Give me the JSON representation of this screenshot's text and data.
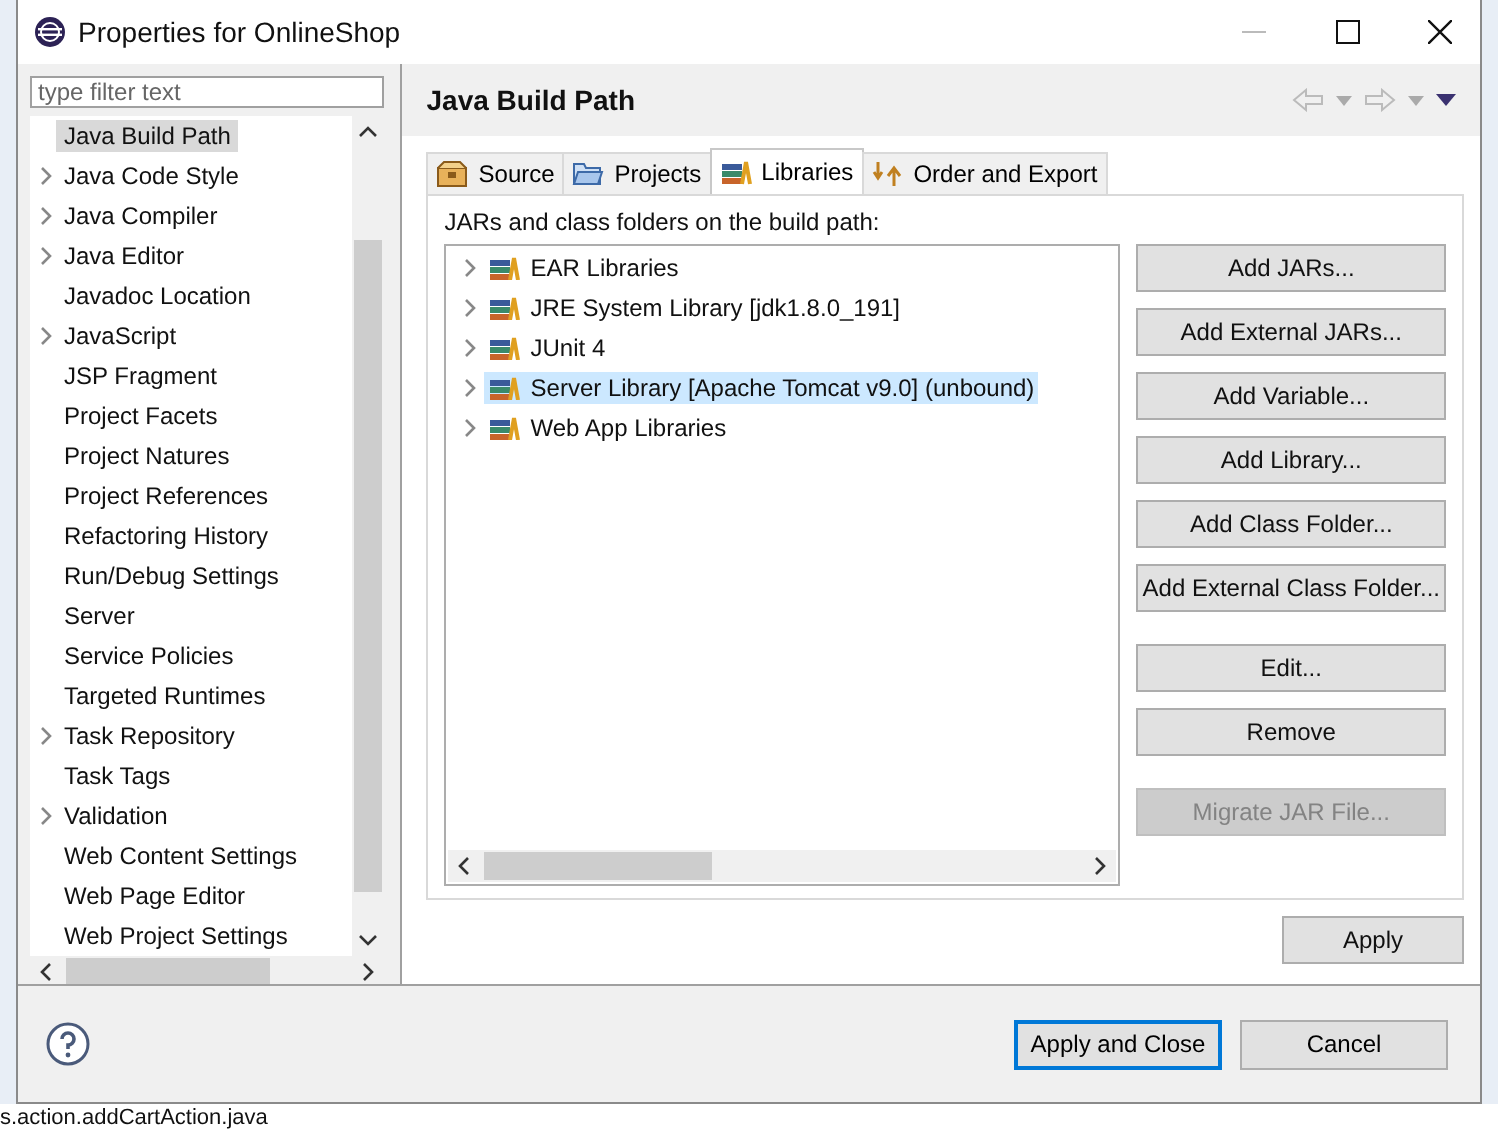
{
  "window": {
    "title": "Properties for OnlineShop"
  },
  "sidebar": {
    "filter_placeholder": "type filter text",
    "items": [
      {
        "label": "Java Build Path",
        "expandable": false,
        "selected": true
      },
      {
        "label": "Java Code Style",
        "expandable": true,
        "selected": false
      },
      {
        "label": "Java Compiler",
        "expandable": true,
        "selected": false
      },
      {
        "label": "Java Editor",
        "expandable": true,
        "selected": false
      },
      {
        "label": "Javadoc Location",
        "expandable": false,
        "selected": false
      },
      {
        "label": "JavaScript",
        "expandable": true,
        "selected": false
      },
      {
        "label": "JSP Fragment",
        "expandable": false,
        "selected": false
      },
      {
        "label": "Project Facets",
        "expandable": false,
        "selected": false
      },
      {
        "label": "Project Natures",
        "expandable": false,
        "selected": false
      },
      {
        "label": "Project References",
        "expandable": false,
        "selected": false
      },
      {
        "label": "Refactoring History",
        "expandable": false,
        "selected": false
      },
      {
        "label": "Run/Debug Settings",
        "expandable": false,
        "selected": false
      },
      {
        "label": "Server",
        "expandable": false,
        "selected": false
      },
      {
        "label": "Service Policies",
        "expandable": false,
        "selected": false
      },
      {
        "label": "Targeted Runtimes",
        "expandable": false,
        "selected": false
      },
      {
        "label": "Task Repository",
        "expandable": true,
        "selected": false
      },
      {
        "label": "Task Tags",
        "expandable": false,
        "selected": false
      },
      {
        "label": "Validation",
        "expandable": true,
        "selected": false
      },
      {
        "label": "Web Content Settings",
        "expandable": false,
        "selected": false
      },
      {
        "label": "Web Page Editor",
        "expandable": false,
        "selected": false
      },
      {
        "label": "Web Project Settings",
        "expandable": false,
        "selected": false
      }
    ]
  },
  "page": {
    "title": "Java Build Path",
    "tabs": [
      {
        "label": "Source",
        "kind": "source",
        "selected": false
      },
      {
        "label": "Projects",
        "kind": "projects",
        "selected": false
      },
      {
        "label": "Libraries",
        "kind": "libraries",
        "selected": true
      },
      {
        "label": "Order and Export",
        "kind": "order",
        "selected": false
      }
    ],
    "list_label": "JARs and class folders on the build path:",
    "libraries": [
      {
        "label": "EAR Libraries",
        "selected": false
      },
      {
        "label": "JRE System Library [jdk1.8.0_191]",
        "selected": false
      },
      {
        "label": "JUnit 4",
        "selected": false
      },
      {
        "label": "Server Library [Apache Tomcat v9.0] (unbound)",
        "selected": true
      },
      {
        "label": "Web App Libraries",
        "selected": false
      }
    ],
    "buttons": [
      {
        "label": "Add JARs...",
        "disabled": false
      },
      {
        "label": "Add External JARs...",
        "disabled": false
      },
      {
        "label": "Add Variable...",
        "disabled": false
      },
      {
        "label": "Add Library...",
        "disabled": false
      },
      {
        "label": "Add Class Folder...",
        "disabled": false
      },
      {
        "label": "Add External Class Folder...",
        "disabled": false
      },
      {
        "label": "Edit...",
        "disabled": false
      },
      {
        "label": "Remove",
        "disabled": false
      },
      {
        "label": "Migrate JAR File...",
        "disabled": true
      }
    ],
    "apply": "Apply"
  },
  "footer": {
    "buttons": [
      {
        "label": "Apply and Close",
        "default": true
      },
      {
        "label": "Cancel",
        "default": false
      }
    ]
  },
  "background_text": "s.action.addCartAction.java"
}
